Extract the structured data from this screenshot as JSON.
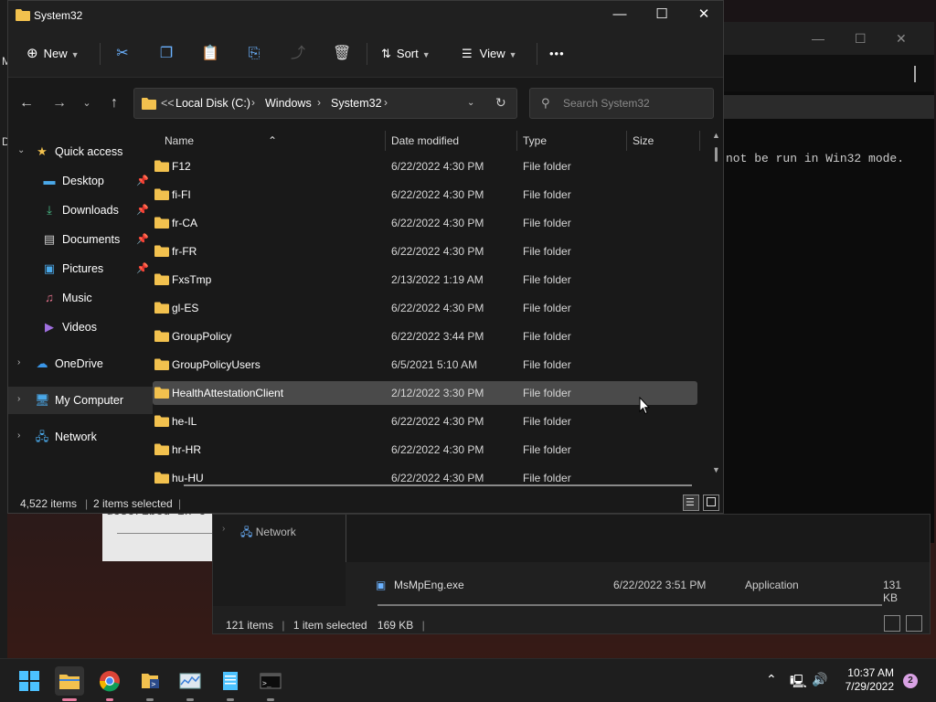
{
  "window": {
    "title": "System32",
    "minimize": "—",
    "maximize": "☐",
    "close": "✕"
  },
  "toolbar": {
    "new_label": "New",
    "sort_label": "Sort",
    "view_label": "View",
    "more_label": "•••"
  },
  "address": {
    "overflow": "<<",
    "crumbs": [
      "Local Disk (C:)",
      "Windows",
      "System32"
    ],
    "search_placeholder": "Search System32"
  },
  "nav": {
    "items": [
      {
        "label": "Quick access",
        "icon": "star-icon"
      },
      {
        "label": "Desktop",
        "icon": "desktop-icon",
        "pinned": true
      },
      {
        "label": "Downloads",
        "icon": "download-icon",
        "pinned": true
      },
      {
        "label": "Documents",
        "icon": "document-icon",
        "pinned": true
      },
      {
        "label": "Pictures",
        "icon": "pictures-icon",
        "pinned": true
      },
      {
        "label": "Music",
        "icon": "music-icon"
      },
      {
        "label": "Videos",
        "icon": "videos-icon"
      },
      {
        "label": "OneDrive",
        "icon": "cloud-icon"
      },
      {
        "label": "My Computer",
        "icon": "computer-icon",
        "selected": true
      },
      {
        "label": "Network",
        "icon": "network-icon"
      }
    ]
  },
  "columns": {
    "name": "Name",
    "date": "Date modified",
    "type": "Type",
    "size": "Size"
  },
  "files": [
    {
      "name": "F12",
      "date": "6/22/2022 4:30 PM",
      "type": "File folder"
    },
    {
      "name": "fi-FI",
      "date": "6/22/2022 4:30 PM",
      "type": "File folder"
    },
    {
      "name": "fr-CA",
      "date": "6/22/2022 4:30 PM",
      "type": "File folder"
    },
    {
      "name": "fr-FR",
      "date": "6/22/2022 4:30 PM",
      "type": "File folder"
    },
    {
      "name": "FxsTmp",
      "date": "2/13/2022 1:19 AM",
      "type": "File folder"
    },
    {
      "name": "gl-ES",
      "date": "6/22/2022 4:30 PM",
      "type": "File folder"
    },
    {
      "name": "GroupPolicy",
      "date": "6/22/2022 3:44 PM",
      "type": "File folder"
    },
    {
      "name": "GroupPolicyUsers",
      "date": "6/5/2021 5:10 AM",
      "type": "File folder"
    },
    {
      "name": "HealthAttestationClient",
      "date": "2/12/2022 3:30 PM",
      "type": "File folder",
      "hover": true
    },
    {
      "name": "he-IL",
      "date": "6/22/2022 4:30 PM",
      "type": "File folder"
    },
    {
      "name": "hr-HR",
      "date": "6/22/2022 4:30 PM",
      "type": "File folder"
    },
    {
      "name": "hu-HU",
      "date": "6/22/2022 4:30 PM",
      "type": "File folder"
    }
  ],
  "status": {
    "count": "4,522 items",
    "selected": "2 items selected"
  },
  "bg_console": {
    "text": "not be run in Win32 mode."
  },
  "bg_doc": {
    "text": "described in c"
  },
  "bg_explorer": {
    "nav_item": "Network",
    "file_name": "MsMpEng.exe",
    "file_date": "6/22/2022 3:51 PM",
    "file_type": "Application",
    "file_size": "131 KB",
    "status_count": "121 items",
    "status_selected": "1 item selected",
    "status_size": "169 KB"
  },
  "left_strip": [
    "M",
    "D"
  ],
  "taskbar": {
    "time": "10:37 AM",
    "date": "7/29/2022",
    "notifications": "2"
  },
  "colors": {
    "folder_yellow": "#f2c14e",
    "accent_blue": "#6bb2ff",
    "hover_row": "#4a4a4a",
    "taskbar_active": "#e87ca0"
  }
}
